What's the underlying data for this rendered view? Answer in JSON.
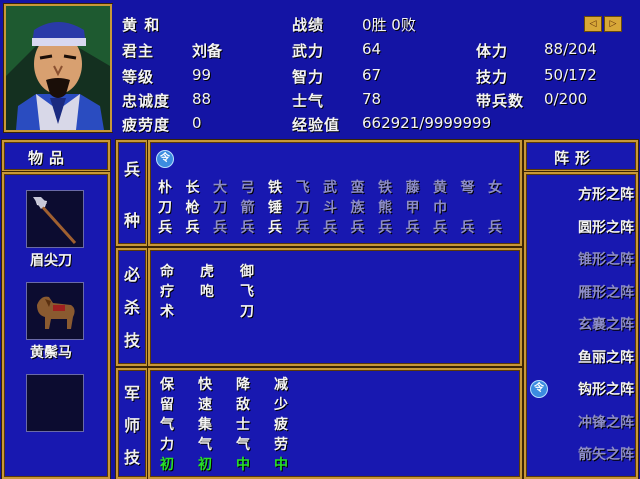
{
  "general": {
    "name": "黄  和",
    "lord_label": "君主",
    "lord": "刘备",
    "level_label": "等级",
    "level": "99",
    "loyalty_label": "忠诚度",
    "loyalty": "88",
    "fatigue_label": "疲劳度",
    "fatigue": "0"
  },
  "stats": {
    "record_label": "战绩",
    "record": "0胜 0败",
    "force_label": "武力",
    "force": "64",
    "intellect_label": "智力",
    "intellect": "67",
    "morale_label": "士气",
    "morale": "78",
    "exp_label": "经验值",
    "exp": "662921/9999999",
    "stamina_label": "体力",
    "stamina": "88/204",
    "skill_label": "技力",
    "skill": "50/172",
    "troops_label": "带兵数",
    "troops": "0/200"
  },
  "items": {
    "title": "物品",
    "list": [
      {
        "name": "眉尖刀",
        "icon": "glaive-icon"
      },
      {
        "name": "黄鬃马",
        "icon": "horse-icon"
      }
    ]
  },
  "troops": {
    "title": [
      "兵",
      "种"
    ],
    "badge": "令",
    "list": [
      {
        "text": [
          "朴",
          "刀",
          "兵"
        ],
        "active": true
      },
      {
        "text": [
          "长",
          "枪",
          "兵"
        ],
        "active": true
      },
      {
        "text": [
          "大",
          "刀",
          "兵"
        ],
        "active": false
      },
      {
        "text": [
          "弓",
          "箭",
          "兵"
        ],
        "active": false
      },
      {
        "text": [
          "铁",
          "锤",
          "兵"
        ],
        "active": true
      },
      {
        "text": [
          "飞",
          "刀",
          "兵"
        ],
        "active": false
      },
      {
        "text": [
          "武",
          "斗",
          "兵"
        ],
        "active": false
      },
      {
        "text": [
          "蛮",
          "族",
          "兵"
        ],
        "active": false
      },
      {
        "text": [
          "铁",
          "熊",
          "兵"
        ],
        "active": false
      },
      {
        "text": [
          "藤",
          "甲",
          "兵"
        ],
        "active": false
      },
      {
        "text": [
          "黄",
          "巾",
          "兵"
        ],
        "active": false
      },
      {
        "text": [
          "弩",
          "",
          "兵"
        ],
        "active": false
      },
      {
        "text": [
          "女",
          "",
          "兵"
        ],
        "active": false
      }
    ]
  },
  "kills": {
    "title": [
      "必",
      "杀",
      "技"
    ],
    "list": [
      {
        "text": [
          "命",
          "疗",
          "术"
        ]
      },
      {
        "text": [
          "虎",
          "咆",
          ""
        ]
      },
      {
        "text": [
          "御",
          "飞",
          "刀"
        ]
      }
    ]
  },
  "tactics": {
    "title": [
      "军",
      "师",
      "技"
    ],
    "list": [
      {
        "text": [
          "保",
          "留",
          "气",
          "力"
        ],
        "level": "初"
      },
      {
        "text": [
          "快",
          "速",
          "集",
          "气"
        ],
        "level": "初"
      },
      {
        "text": [
          "降",
          "敌",
          "士",
          "气"
        ],
        "level": "中"
      },
      {
        "text": [
          "减",
          "少",
          "疲",
          "劳"
        ],
        "level": "中"
      }
    ]
  },
  "formations": {
    "title": "阵形",
    "selected_badge": "令",
    "list": [
      {
        "label": "方形之阵",
        "active": true
      },
      {
        "label": "圆形之阵",
        "active": true
      },
      {
        "label": "锥形之阵",
        "active": false
      },
      {
        "label": "雁形之阵",
        "active": false
      },
      {
        "label": "玄襄之阵",
        "active": false
      },
      {
        "label": "鱼丽之阵",
        "active": true
      },
      {
        "label": "钩形之阵",
        "active": true,
        "selected": true
      },
      {
        "label": "冲锋之阵",
        "active": false
      },
      {
        "label": "箭矢之阵",
        "active": false
      }
    ]
  },
  "nav": {
    "prev": "◁",
    "next": "▷"
  },
  "colors": {
    "panel": "#1818b0",
    "border": "#c89838",
    "dim": "#8c8cc8",
    "green": "#28e028"
  }
}
